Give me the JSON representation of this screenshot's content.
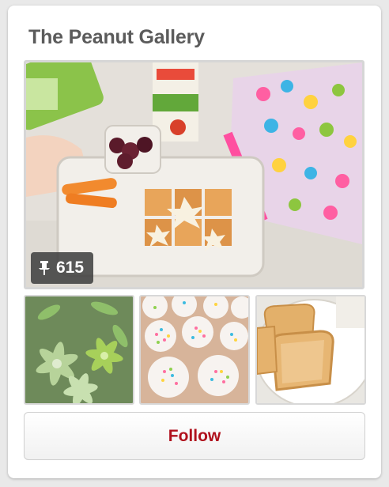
{
  "board": {
    "title": "The Peanut Gallery",
    "pin_count": "615"
  },
  "actions": {
    "follow_label": "Follow"
  },
  "colors": {
    "follow_text": "#b0111d",
    "title_text": "#5b5b5b",
    "badge_bg": "#3c3c3c"
  }
}
